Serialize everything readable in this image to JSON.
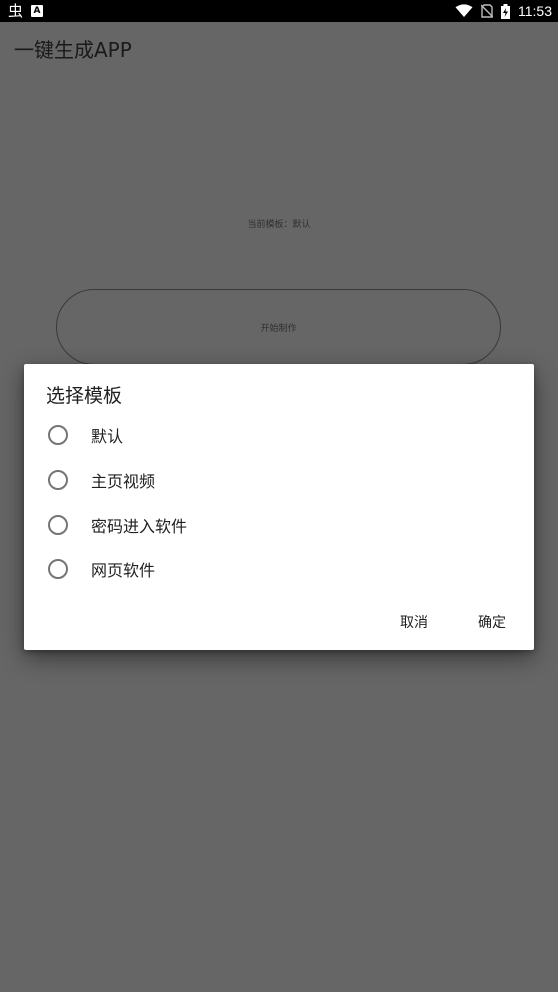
{
  "status_bar": {
    "time": "11:53",
    "app_icon": "虫",
    "badge_icon": "A"
  },
  "app": {
    "title": "一键生成APP",
    "current_template_text": "当前模板：默认",
    "start_button_label": "开始制作"
  },
  "dialog": {
    "title": "选择模板",
    "options": [
      {
        "label": "默认"
      },
      {
        "label": "主页视频"
      },
      {
        "label": "密码进入软件"
      },
      {
        "label": "网页软件"
      }
    ],
    "cancel_label": "取消",
    "confirm_label": "确定"
  }
}
